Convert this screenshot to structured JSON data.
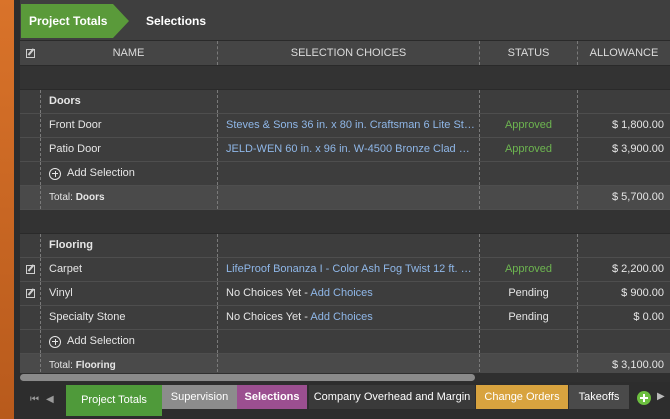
{
  "breadcrumb": {
    "current": "Project Totals",
    "next": "Selections"
  },
  "columns": {
    "name": "NAME",
    "choices": "SELECTION CHOICES",
    "status": "STATUS",
    "allowance": "ALLOWANCE"
  },
  "groups": [
    {
      "title": "Doors",
      "rows": [
        {
          "name": "Front Door",
          "choice": "Steves & Sons 36 in. x 80 in. Craftsman 6 Lite Stained...",
          "status": "Approved",
          "allowance": "$ 1,800.00"
        },
        {
          "name": "Patio Door",
          "choice": "JELD-WEN 60 in. x 96 in. W-4500 Bronze Clad Wood ...",
          "status": "Approved",
          "allowance": "$ 3,900.00"
        }
      ],
      "add_label": "Add Selection",
      "total_label": "Total:",
      "total_name": "Doors",
      "total": "$ 5,700.00"
    },
    {
      "title": "Flooring",
      "rows": [
        {
          "name": "Carpet",
          "choice": "LifeProof Bonanza I - Color Ash Fog Twist 12 ft. Carp...",
          "status": "Approved",
          "allowance": "$ 2,200.00"
        },
        {
          "name": "Vinyl",
          "no_choice": "No Choices Yet -",
          "add_choices": "Add Choices",
          "status": "Pending",
          "allowance": "$ 900.00"
        },
        {
          "name": "Specialty Stone",
          "no_choice": "No Choices Yet -",
          "add_choices": "Add Choices",
          "status": "Pending",
          "allowance": "$ 0.00"
        }
      ],
      "add_label": "Add Selection",
      "total_label": "Total:",
      "total_name": "Flooring",
      "total": "$ 3,100.00"
    }
  ],
  "tabs": [
    {
      "label": "Project Totals",
      "color": "#4f9a3a"
    },
    {
      "label": "Supervision",
      "color": "#8c8c8c"
    },
    {
      "label": "Selections",
      "color": "#9b4f90"
    },
    {
      "label": "Company Overhead and Margin",
      "color": "#3a3a3a"
    },
    {
      "label": "Change Orders",
      "color": "#d8a33f"
    },
    {
      "label": "Takeoffs",
      "color": "#4a4a4a"
    }
  ],
  "colors": {
    "accent": "#5a9a3a",
    "link": "#8fb7e8",
    "approved": "#6db550"
  }
}
